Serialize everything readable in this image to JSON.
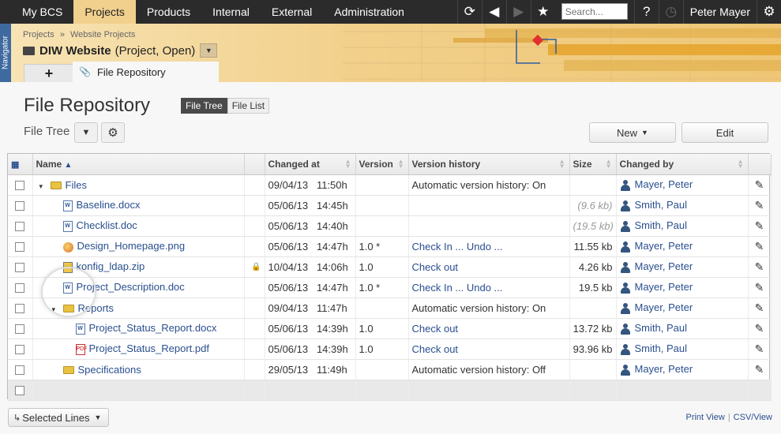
{
  "topnav": {
    "tabs": [
      {
        "label": "My BCS",
        "active": false
      },
      {
        "label": "Projects",
        "active": true
      },
      {
        "label": "Products",
        "active": false
      },
      {
        "label": "Internal",
        "active": false
      },
      {
        "label": "External",
        "active": false
      },
      {
        "label": "Administration",
        "active": false
      }
    ],
    "search_placeholder": "Search...",
    "help_label": "?",
    "user_name": "Peter Mayer",
    "icons": [
      "refresh-icon",
      "back-icon",
      "forward-icon",
      "star-icon",
      "help-icon",
      "stopwatch-icon",
      "gear-icon"
    ]
  },
  "navigator": {
    "label": "Navigator"
  },
  "header": {
    "breadcrumb": [
      "Projects",
      "»",
      "Website Projects"
    ],
    "project_name": "DIW Website",
    "project_meta": "(Project, Open)",
    "add_tab_label": "+",
    "active_tab_label": "File Repository"
  },
  "page": {
    "title": "File Repository",
    "view_options": [
      {
        "label": "File Tree",
        "active": true
      },
      {
        "label": "File List",
        "active": false
      }
    ],
    "subtitle": "File Tree",
    "new_button": "New",
    "edit_button": "Edit"
  },
  "grid": {
    "columns": [
      "Name",
      "Changed at",
      "Version",
      "Version history",
      "Size",
      "Changed by"
    ],
    "sorted_by": "Name",
    "rows": [
      {
        "indent": 0,
        "expander": "▾",
        "icon": "folder",
        "name": "Files",
        "lock": "",
        "date": "09/04/13",
        "time": "11:50h",
        "version": "",
        "history": "Automatic version history: On",
        "history_link": false,
        "size": "",
        "size_muted": false,
        "user": "Mayer, Peter"
      },
      {
        "indent": 1,
        "expander": "",
        "icon": "docx",
        "name": "Baseline.docx",
        "lock": "",
        "date": "05/06/13",
        "time": "14:45h",
        "version": "",
        "history": "",
        "history_link": false,
        "size": "(9.6 kb)",
        "size_muted": true,
        "user": "Smith, Paul"
      },
      {
        "indent": 1,
        "expander": "",
        "icon": "docx",
        "name": "Checklist.doc",
        "lock": "",
        "date": "05/06/13",
        "time": "14:40h",
        "version": "",
        "history": "",
        "history_link": false,
        "size": "(19.5 kb)",
        "size_muted": true,
        "user": "Smith, Paul"
      },
      {
        "indent": 1,
        "expander": "",
        "icon": "png",
        "name": "Design_Homepage.png",
        "lock": "",
        "date": "05/06/13",
        "time": "14:47h",
        "version": "1.0 *",
        "history": "Check In ... Undo ...",
        "history_link": true,
        "size": "11.55 kb",
        "size_muted": false,
        "user": "Mayer, Peter"
      },
      {
        "indent": 1,
        "expander": "",
        "icon": "zip",
        "name": "konfig_ldap.zip",
        "lock": "🔒",
        "date": "10/04/13",
        "time": "14:06h",
        "version": "1.0",
        "history": "Check out",
        "history_link": true,
        "size": "4.26 kb",
        "size_muted": false,
        "user": "Mayer, Peter"
      },
      {
        "indent": 1,
        "expander": "",
        "icon": "docx",
        "name": "Project_Description.doc",
        "lock": "",
        "date": "05/06/13",
        "time": "14:47h",
        "version": "1.0 *",
        "history": "Check In ... Undo ...",
        "history_link": true,
        "size": "19.5 kb",
        "size_muted": false,
        "user": "Mayer, Peter"
      },
      {
        "indent": 1,
        "expander": "▾",
        "icon": "folder",
        "name": "Reports",
        "lock": "",
        "date": "09/04/13",
        "time": "11:47h",
        "version": "",
        "history": "Automatic version history: On",
        "history_link": false,
        "size": "",
        "size_muted": false,
        "user": "Mayer, Peter"
      },
      {
        "indent": 2,
        "expander": "",
        "icon": "docx",
        "name": "Project_Status_Report.docx",
        "lock": "",
        "date": "05/06/13",
        "time": "14:39h",
        "version": "1.0",
        "history": "Check out",
        "history_link": true,
        "size": "13.72 kb",
        "size_muted": false,
        "user": "Smith, Paul"
      },
      {
        "indent": 2,
        "expander": "",
        "icon": "pdf",
        "name": "Project_Status_Report.pdf",
        "lock": "",
        "date": "05/06/13",
        "time": "14:39h",
        "version": "1.0",
        "history": "Check out",
        "history_link": true,
        "size": "93.96 kb",
        "size_muted": false,
        "user": "Smith, Paul"
      },
      {
        "indent": 1,
        "expander": "",
        "icon": "folder",
        "name": "Specifications",
        "lock": "",
        "date": "29/05/13",
        "time": "11:49h",
        "version": "",
        "history": "Automatic version history: Off",
        "history_link": false,
        "size": "",
        "size_muted": false,
        "user": "Mayer, Peter"
      }
    ]
  },
  "footer": {
    "selected_lines": "Selected Lines",
    "links": [
      "Print View",
      "CSV/View"
    ]
  }
}
